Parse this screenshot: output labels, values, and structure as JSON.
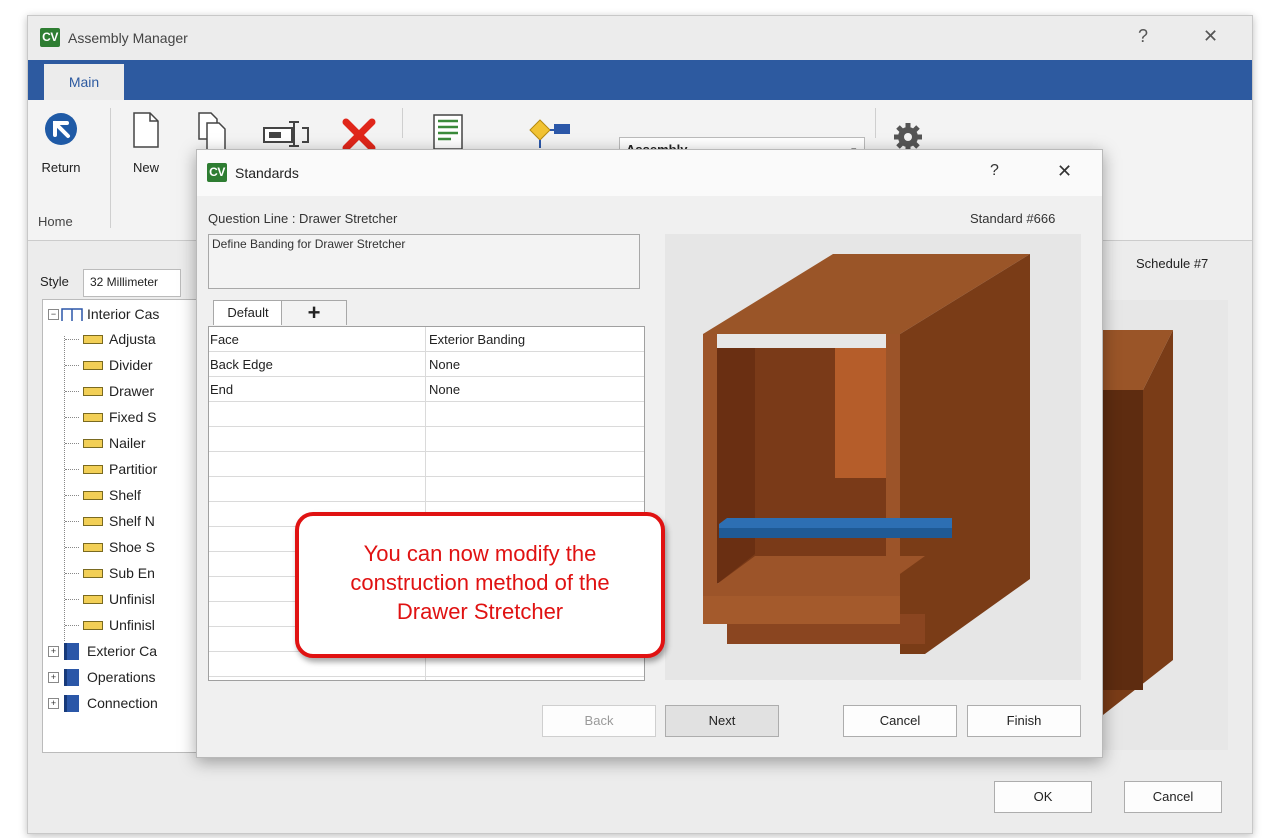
{
  "main_window": {
    "title": "Assembly Manager",
    "logo": "CV",
    "help": "?",
    "close": "✕"
  },
  "ribbon": {
    "tab_main": "Main",
    "return_label": "Return",
    "new_label": "New",
    "group_home": "Home",
    "assembly_select": "Assembly"
  },
  "left_panel": {
    "style_label": "Style",
    "style_value": "32 Millimeter",
    "schedule": "Schedule #7",
    "tree": {
      "root": "Interior Cas",
      "children": [
        "Adjusta",
        "Divider",
        "Drawer",
        "Fixed S",
        "Nailer",
        "Partitior",
        "Shelf",
        "Shelf N",
        "Shoe S",
        "Sub En",
        "Unfinisl",
        "Unfinisl"
      ],
      "siblings": [
        "Exterior Ca",
        "Operations",
        "Connection"
      ]
    }
  },
  "main_buttons": {
    "ok": "OK",
    "cancel": "Cancel"
  },
  "dialog": {
    "logo": "CV",
    "title": "Standards",
    "help": "?",
    "close": "✕",
    "question_line": "Question Line : Drawer Stretcher",
    "standard_number": "Standard #666",
    "description": "Define Banding for Drawer Stretcher",
    "tabs": {
      "default": "Default",
      "add": "+"
    },
    "grid_rows": [
      {
        "name": "Face",
        "value": "Exterior Banding"
      },
      {
        "name": "Back Edge",
        "value": "None"
      },
      {
        "name": "End",
        "value": "None"
      }
    ],
    "buttons": {
      "back": "Back",
      "next": "Next",
      "cancel": "Cancel",
      "finish": "Finish"
    }
  },
  "callout": {
    "text": "You can now modify the\nconstruction method of the\nDrawer Stretcher",
    "border_color": "#e01212"
  },
  "colors": {
    "ribbon_blue": "#2d5aa0",
    "cabinet_brown": "#8b4a22",
    "stretcher_blue": "#2d6fb3",
    "logo_green": "#2e7d32"
  },
  "icons": [
    "return-icon",
    "new-document-icon",
    "copy-document-icon",
    "rename-icon",
    "delete-icon",
    "list-edit-icon",
    "flowchart-icon",
    "settings-gear-icon",
    "add-tab-icon"
  ]
}
